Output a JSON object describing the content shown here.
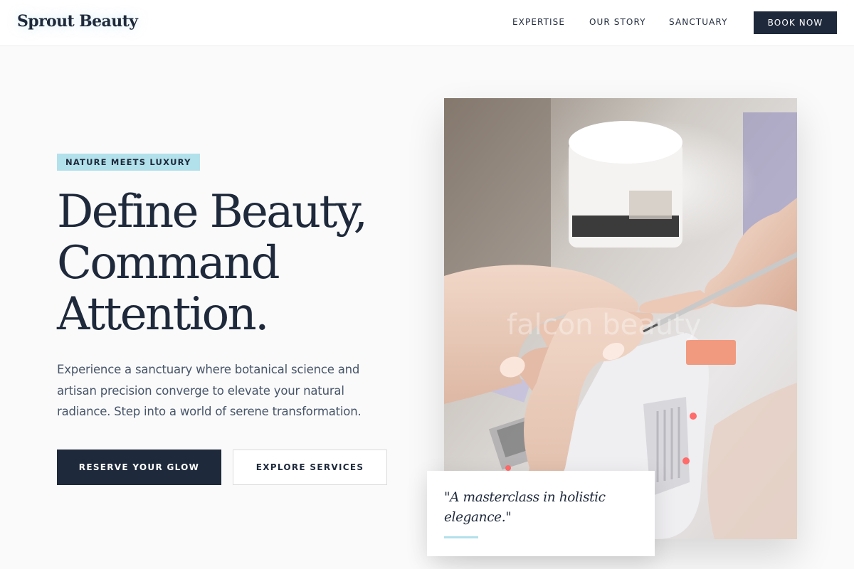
{
  "brand": {
    "name": "Sprout Beauty",
    "accent_color": "#b2e1eb",
    "primary_color": "#1e293b"
  },
  "nav": {
    "items": [
      {
        "label": "EXPERTISE"
      },
      {
        "label": "OUR STORY"
      },
      {
        "label": "SANCTUARY"
      }
    ],
    "cta_label": "BOOK NOW"
  },
  "hero": {
    "tag": "NATURE MEETS LUXURY",
    "headline_lines": [
      "Define Beauty,",
      "Command",
      "Attention."
    ],
    "description": "Experience a sanctuary where botanical science and artisan precision converge to elevate your natural radiance. Step into a world of serene transformation.",
    "primary_button": "RESERVE YOUR GLOW",
    "secondary_button": "EXPLORE SERVICES",
    "image": {
      "subject": "manicure-photo",
      "watermark": "falcon beauty"
    },
    "quote": "\"A masterclass in holistic elegance.\""
  }
}
